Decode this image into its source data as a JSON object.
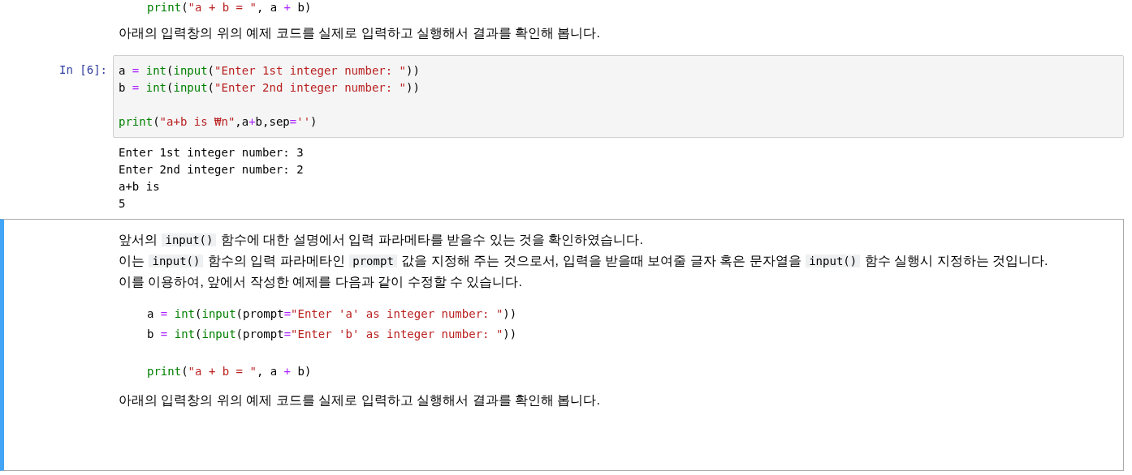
{
  "top_cell": {
    "code_lines": [
      {
        "blank_line_before": false,
        "tokens": [
          {
            "kind": "builtin",
            "text": "print"
          },
          {
            "kind": "plain",
            "text": "("
          },
          {
            "kind": "string",
            "text": "\"a + b = \""
          },
          {
            "kind": "plain",
            "text": ", a "
          },
          {
            "kind": "op",
            "text": "+"
          },
          {
            "kind": "plain",
            "text": " b)"
          }
        ]
      }
    ],
    "paragraph": "아래의 입력창의 위의 예제 코드를 실제로 입력하고 실행해서 결과를 확인해 봅니다."
  },
  "code_cell": {
    "prompt": "In [6]:",
    "code_lines": [
      {
        "blank_line_before": false,
        "tokens": [
          {
            "kind": "plain",
            "text": "a "
          },
          {
            "kind": "op",
            "text": "= "
          },
          {
            "kind": "builtin",
            "text": "int"
          },
          {
            "kind": "plain",
            "text": "("
          },
          {
            "kind": "builtin",
            "text": "input"
          },
          {
            "kind": "plain",
            "text": "("
          },
          {
            "kind": "string",
            "text": "\"Enter 1st integer number: \""
          },
          {
            "kind": "plain",
            "text": "))"
          }
        ]
      },
      {
        "blank_line_before": false,
        "tokens": [
          {
            "kind": "plain",
            "text": "b "
          },
          {
            "kind": "op",
            "text": "= "
          },
          {
            "kind": "builtin",
            "text": "int"
          },
          {
            "kind": "plain",
            "text": "("
          },
          {
            "kind": "builtin",
            "text": "input"
          },
          {
            "kind": "plain",
            "text": "("
          },
          {
            "kind": "string",
            "text": "\"Enter 2nd integer number: \""
          },
          {
            "kind": "plain",
            "text": "))"
          }
        ]
      },
      {
        "blank_line_before": true,
        "tokens": [
          {
            "kind": "builtin",
            "text": "print"
          },
          {
            "kind": "plain",
            "text": "("
          },
          {
            "kind": "string",
            "text": "\"a+b is ₩n\""
          },
          {
            "kind": "plain",
            "text": ",a"
          },
          {
            "kind": "op",
            "text": "+"
          },
          {
            "kind": "plain",
            "text": "b,sep"
          },
          {
            "kind": "op",
            "text": "="
          },
          {
            "kind": "string",
            "text": "''"
          },
          {
            "kind": "plain",
            "text": ")"
          }
        ]
      }
    ],
    "output_lines": [
      "Enter 1st integer number: 3",
      "Enter 2nd integer number: 2",
      "a+b is",
      "5"
    ]
  },
  "markdown_cell": {
    "selected": true,
    "lines": [
      [
        {
          "kind": "text",
          "text": "앞서의 "
        },
        {
          "kind": "code",
          "text": "input()"
        },
        {
          "kind": "text",
          "text": " 함수에 대한 설명에서 입력 파라메타를 받을수 있는 것을 확인하였습니다."
        }
      ],
      [
        {
          "kind": "text",
          "text": "이는 "
        },
        {
          "kind": "code",
          "text": "input()"
        },
        {
          "kind": "text",
          "text": " 함수의 입력 파라메타인 "
        },
        {
          "kind": "code",
          "text": "prompt"
        },
        {
          "kind": "text",
          "text": " 값을 지정해 주는 것으로서, 입력을 받을때 보여줄 글자 혹은 문자열을 "
        },
        {
          "kind": "code",
          "text": "input()"
        },
        {
          "kind": "text",
          "text": " 함수 실행시 지정하는 것입니다."
        }
      ],
      [
        {
          "kind": "text",
          "text": "이를 이용하여, 앞에서 작성한 예제를 다음과 같이 수정할 수 있습니다."
        }
      ]
    ],
    "code_lines": [
      {
        "blank_line_before": false,
        "tokens": [
          {
            "kind": "plain",
            "text": "a "
          },
          {
            "kind": "op",
            "text": "= "
          },
          {
            "kind": "builtin",
            "text": "int"
          },
          {
            "kind": "plain",
            "text": "("
          },
          {
            "kind": "builtin",
            "text": "input"
          },
          {
            "kind": "plain",
            "text": "(prompt"
          },
          {
            "kind": "op",
            "text": "="
          },
          {
            "kind": "string",
            "text": "\"Enter 'a' as integer number: \""
          },
          {
            "kind": "plain",
            "text": "))"
          }
        ]
      },
      {
        "blank_line_before": false,
        "tokens": [
          {
            "kind": "plain",
            "text": "b "
          },
          {
            "kind": "op",
            "text": "= "
          },
          {
            "kind": "builtin",
            "text": "int"
          },
          {
            "kind": "plain",
            "text": "("
          },
          {
            "kind": "builtin",
            "text": "input"
          },
          {
            "kind": "plain",
            "text": "(prompt"
          },
          {
            "kind": "op",
            "text": "="
          },
          {
            "kind": "string",
            "text": "\"Enter 'b' as integer number: \""
          },
          {
            "kind": "plain",
            "text": "))"
          }
        ]
      },
      {
        "blank_line_before": true,
        "tokens": [
          {
            "kind": "builtin",
            "text": "print"
          },
          {
            "kind": "plain",
            "text": "("
          },
          {
            "kind": "string",
            "text": "\"a + b = \""
          },
          {
            "kind": "plain",
            "text": ", a "
          },
          {
            "kind": "op",
            "text": "+"
          },
          {
            "kind": "plain",
            "text": " b)"
          }
        ]
      }
    ],
    "paragraph": "아래의 입력창의 위의 예제 코드를 실제로 입력하고 실행해서 결과를 확인해 봅니다."
  }
}
